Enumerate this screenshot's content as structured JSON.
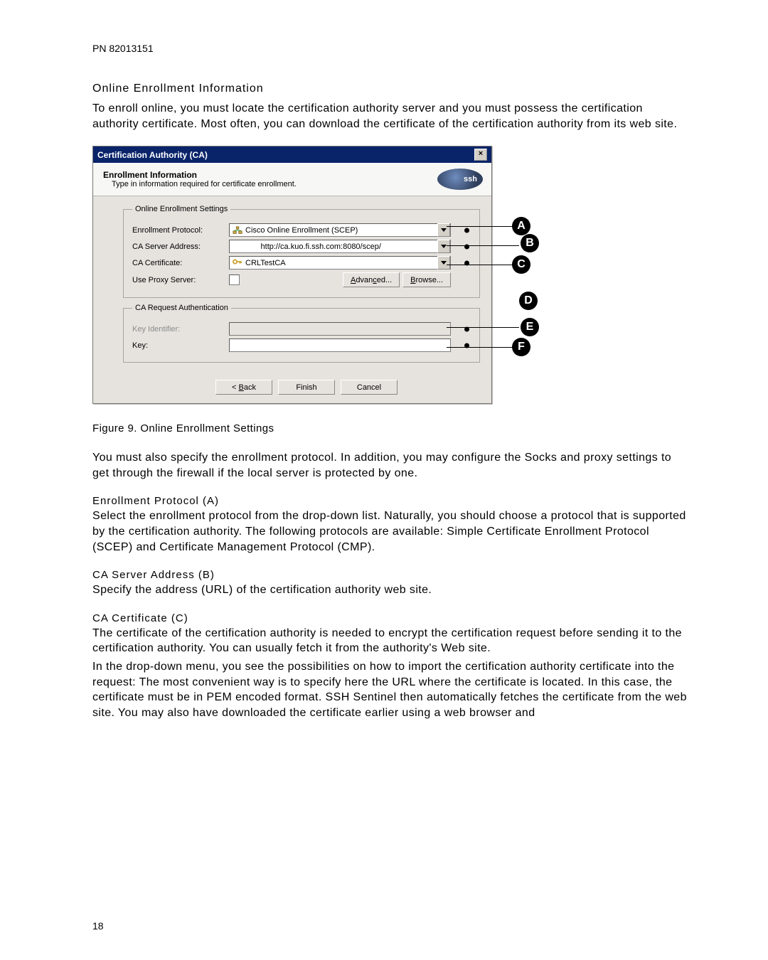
{
  "header": {
    "pn": "PN 82013151"
  },
  "title": "Online Enrollment Information",
  "intro": "To enroll online, you must locate the certification authority server and you must possess the certification authority certificate. Most often, you can download the certificate of the certification authority from its web site.",
  "dialog": {
    "title": "Certification Authority (CA)",
    "close": "×",
    "banner_title": "Enrollment Information",
    "banner_sub": "Type in information required for certificate enrollment.",
    "logo_text": "ssh",
    "frame1_legend": "Online Enrollment Settings",
    "protocol_lbl": "Enrollment Protocol:",
    "protocol_val": "Cisco Online Enrollment (SCEP)",
    "server_lbl": "CA Server Address:",
    "server_val": "http://ca.kuo.fi.ssh.com:8080/scep/",
    "cert_lbl": "CA Certificate:",
    "cert_val": "CRLTestCA",
    "proxy_lbl": "Use Proxy Server:",
    "advanced": "Advanced...",
    "browse": "Browse...",
    "frame2_legend": "CA Request Authentication",
    "keyid_lbl": "Key Identifier:",
    "key_lbl": "Key:",
    "back": "< Back",
    "finish": "Finish",
    "cancel": "Cancel"
  },
  "figcap": "Figure 9.  Online Enrollment Settings",
  "para2": "You must also specify the enrollment protocol. In addition, you may configure the Socks and proxy settings to get through the firewall if the local server is protected by one.",
  "sections": {
    "a_h": "Enrollment Protocol (A)",
    "a_p": "Select the enrollment protocol from the drop-down list. Naturally, you should choose a protocol that is supported by the certification authority. The following protocols are available: Simple Certificate Enrollment Protocol (SCEP) and Certificate Management Protocol (CMP).",
    "b_h": "CA Server Address (B)",
    "b_p": "Specify the address (URL) of the certification authority web site.",
    "c_h": "CA Certificate (C)",
    "c_p1": "The certificate of the certification authority is needed to encrypt the certification request before sending it to the certification authority. You can usually fetch it from the authority's Web site.",
    "c_p2": "In the drop-down menu, you see the possibilities on how to import the certification authority certificate into the request: The most convenient way is to specify here the URL where the certificate is located. In this case, the certificate must be in PEM encoded format. SSH Sentinel then automatically fetches the certificate from the web site. You may also have downloaded the certificate earlier using a web browser and"
  },
  "callouts": {
    "A": "A",
    "B": "B",
    "C": "C",
    "D": "D",
    "E": "E",
    "F": "F"
  },
  "pagenum": "18"
}
